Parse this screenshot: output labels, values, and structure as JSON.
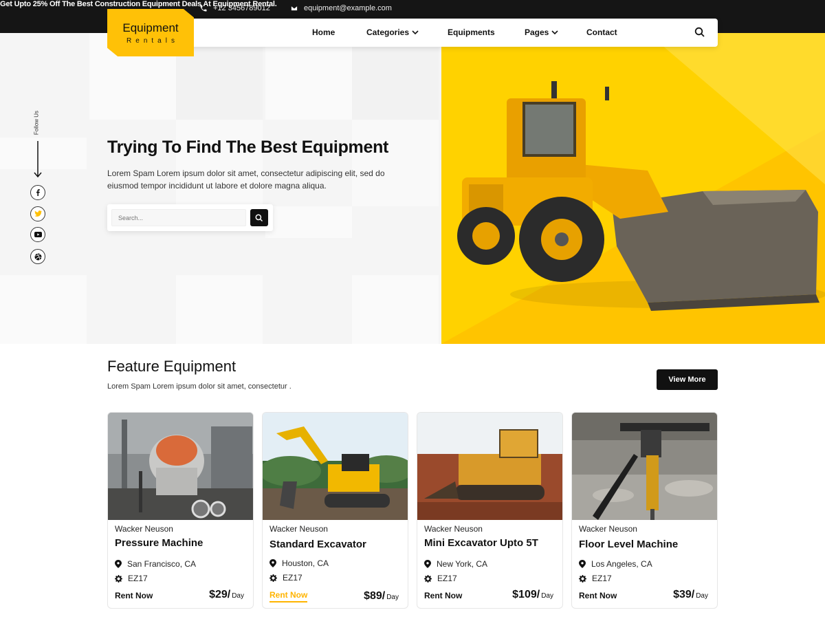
{
  "topbar": {
    "phone": "+12 3456789012",
    "email": "equipment@example.com",
    "promo": "Get Upto 25% Off The Best Construction Equipment Deals At Equipment Rental."
  },
  "logo": {
    "title": "Equipment",
    "subtitle": "Rentals"
  },
  "nav": {
    "items": [
      {
        "label": "Home"
      },
      {
        "label": "Categories"
      },
      {
        "label": "Equipments"
      },
      {
        "label": "Pages"
      },
      {
        "label": "Contact"
      }
    ]
  },
  "social": {
    "label": "Follow Us",
    "icons": [
      "facebook-icon",
      "twitter-icon",
      "youtube-icon",
      "dribbble-icon"
    ]
  },
  "hero": {
    "title": "Trying To Find The Best Equipment",
    "description": "Lorem Spam Lorem ipsum dolor sit amet, consectetur adipiscing elit, sed do eiusmod tempor incididunt ut labore et dolore magna aliqua.",
    "search_placeholder": "Search..."
  },
  "feature": {
    "title": "Feature Equipment",
    "subtitle": "Lorem Spam Lorem ipsum dolor sit amet, consectetur .",
    "view_more": "View More"
  },
  "cards": [
    {
      "brand": "Wacker Neuson",
      "title": "Pressure Machine",
      "location": "San Francisco, CA",
      "model": "EZ17",
      "rent": "Rent Now",
      "price": "$29/",
      "unit": "Day",
      "image": "cement-mixer"
    },
    {
      "brand": "Wacker Neuson",
      "title": "Standard Excavator",
      "location": "Houston, CA",
      "model": "EZ17",
      "rent": "Rent Now",
      "price": "$89/",
      "unit": "Day",
      "image": "excavator"
    },
    {
      "brand": "Wacker Neuson",
      "title": "Mini Excavator Upto 5T",
      "location": "New York, CA",
      "model": "EZ17",
      "rent": "Rent Now",
      "price": "$109/",
      "unit": "Day",
      "image": "bulldozer"
    },
    {
      "brand": "Wacker Neuson",
      "title": "Floor Level Machine",
      "location": "Los Angeles, CA",
      "model": "EZ17",
      "rent": "Rent Now",
      "price": "$39/",
      "unit": "Day",
      "image": "jackhammer"
    }
  ],
  "colors": {
    "accent": "#ffc107",
    "hero_yellow": "#ffd200",
    "dark": "#151515"
  }
}
